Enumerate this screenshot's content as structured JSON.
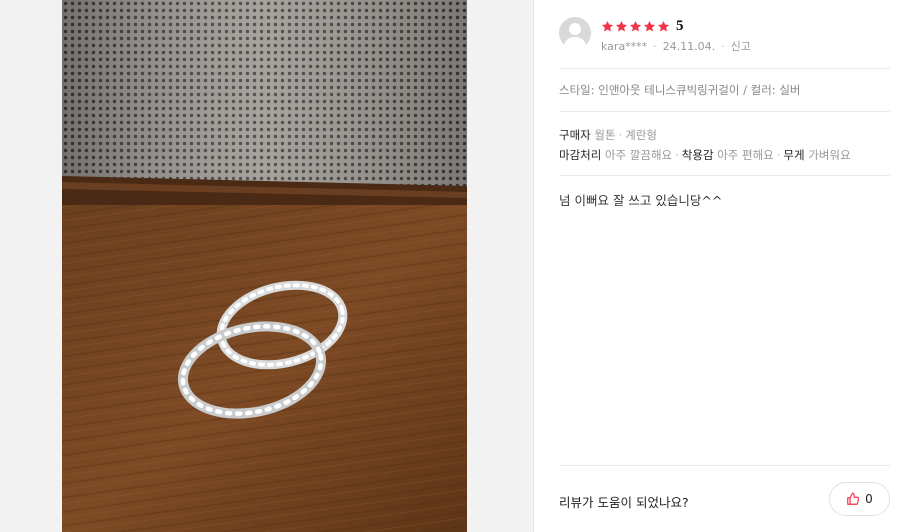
{
  "review": {
    "rating": {
      "value": 5,
      "max": 5,
      "label": "5",
      "star_color": "#f0344a"
    },
    "reviewer_name": "kara****",
    "date": "24.11.04.",
    "report_label": "신고",
    "option_text": "스타일: 인앤아웃 테니스큐빅링귀걸이 / 컬러: 실버",
    "attributes": {
      "buyer_label": "구매자",
      "buyer_values": [
        "월톤",
        "계란형"
      ],
      "finish_label": "마감처리",
      "finish_value": "아주 깔끔해요",
      "comfort_label": "착용감",
      "comfort_value": "아주 편해요",
      "weight_label": "무게",
      "weight_value": "가벼워요"
    },
    "text": "넘 이뻐요 잘 쓰고 있습니당^^",
    "helpful_question": "리뷰가 도움이 되었나요?",
    "like_count": "0"
  },
  "icons": {
    "avatar": "user-avatar-placeholder",
    "star": "star-icon",
    "thumb": "thumbs-up-icon"
  }
}
